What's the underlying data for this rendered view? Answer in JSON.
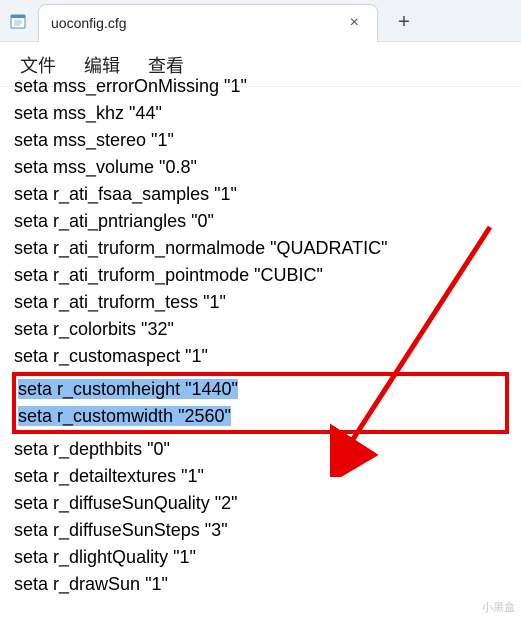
{
  "titlebar": {
    "filename": "uoconfig.cfg",
    "close_label": "×",
    "add_label": "+"
  },
  "menu": {
    "file": "文件",
    "edit": "编辑",
    "view": "查看"
  },
  "lines_top": [
    "seta mss_errorOnMissing \"1\"",
    "seta mss_khz \"44\"",
    "seta mss_stereo \"1\"",
    "seta mss_volume \"0.8\"",
    "seta r_ati_fsaa_samples \"1\"",
    "seta r_ati_pntriangles \"0\"",
    "seta r_ati_truform_normalmode \"QUADRATIC\"",
    "seta r_ati_truform_pointmode \"CUBIC\"",
    "seta r_ati_truform_tess \"1\"",
    "seta r_colorbits \"32\"",
    "seta r_customaspect \"1\""
  ],
  "highlight": {
    "line1": "seta r_customheight \"1440\"",
    "line2": "seta r_customwidth \"2560\""
  },
  "lines_bottom": [
    "seta r_depthbits \"0\"",
    "seta r_detailtextures \"1\"",
    "seta r_diffuseSunQuality \"2\"",
    "seta r_diffuseSunSteps \"3\"",
    "seta r_dlightQuality \"1\"",
    "seta r_drawSun \"1\""
  ],
  "watermark": "小黑盒"
}
